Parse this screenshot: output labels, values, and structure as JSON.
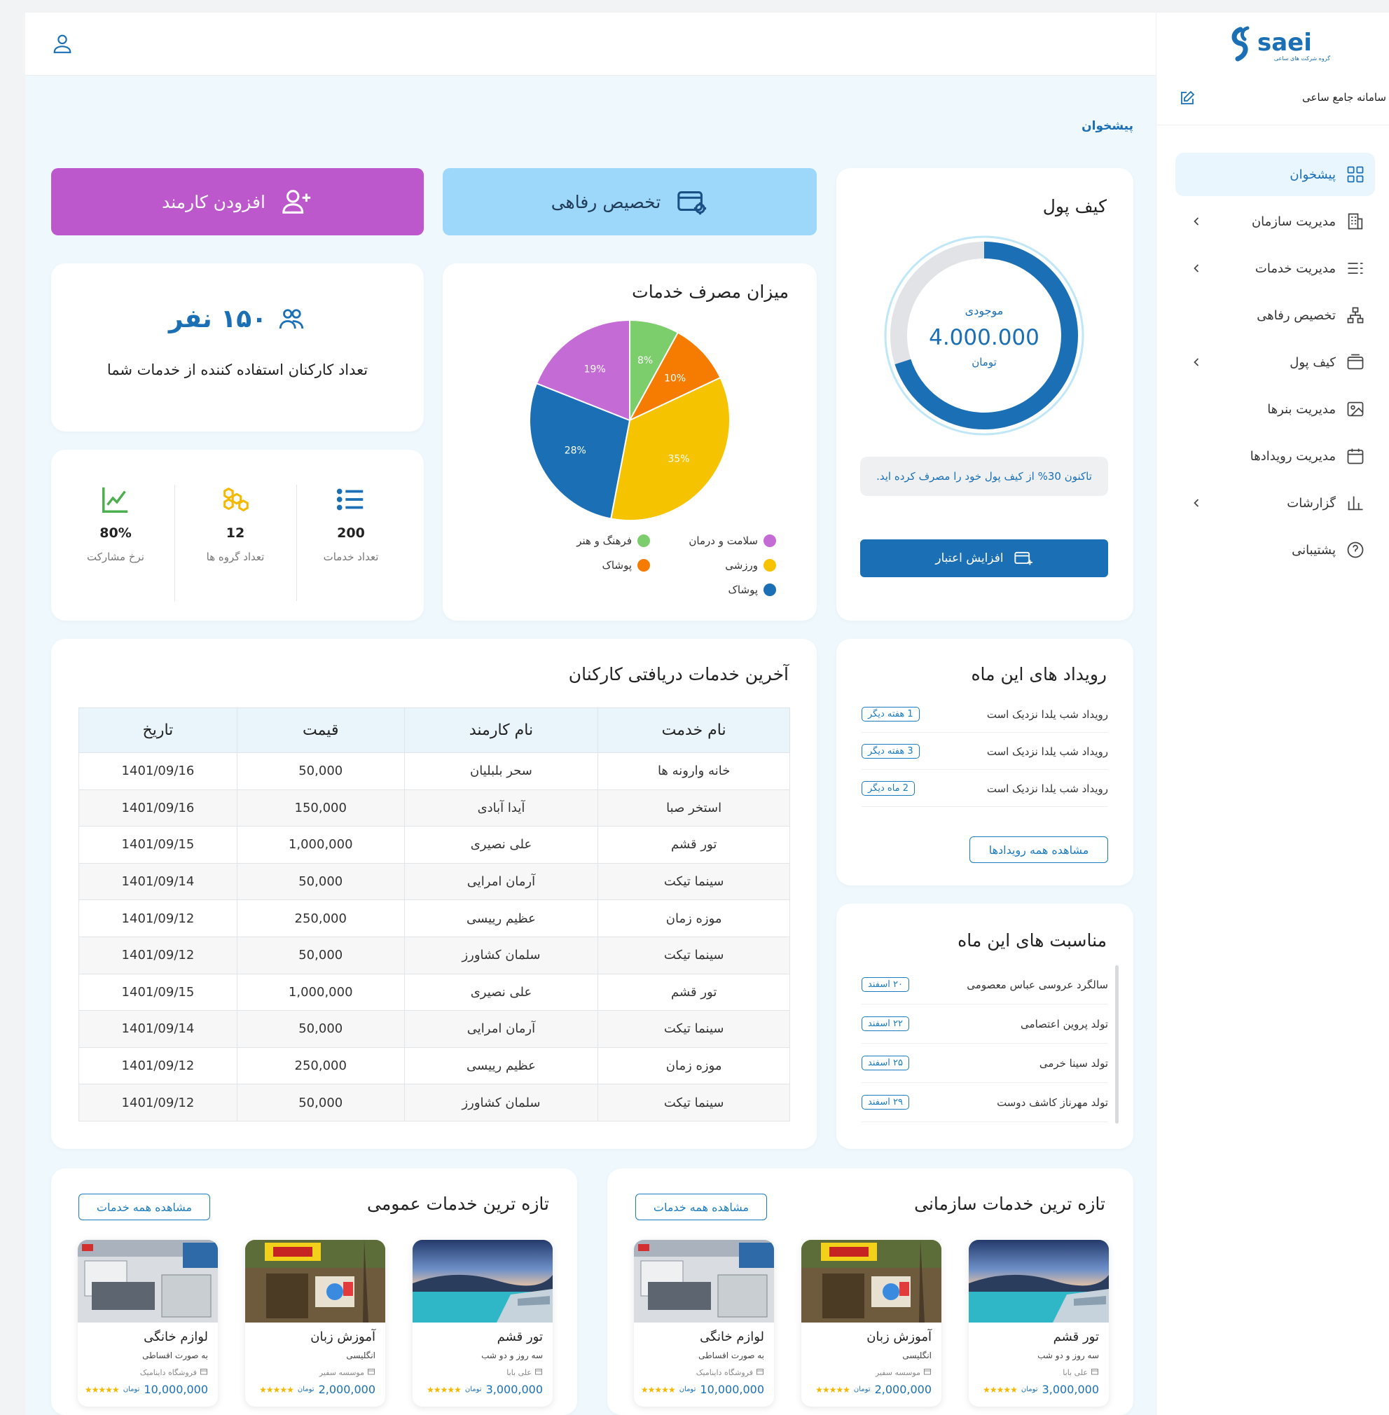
{
  "sidebar": {
    "logo_text": "saei",
    "logo_sub": "گروه شرکت های ساعی",
    "system_title": "سامانه جامع ساعی",
    "items": [
      {
        "label": "پیشخوان",
        "active": true,
        "has_chevron": false
      },
      {
        "label": "مدیریت سازمان",
        "active": false,
        "has_chevron": true
      },
      {
        "label": "مدیریت خدمات",
        "active": false,
        "has_chevron": true
      },
      {
        "label": "تخصیص رفاهی",
        "active": false,
        "has_chevron": false
      },
      {
        "label": "کیف پول",
        "active": false,
        "has_chevron": true
      },
      {
        "label": "مدیریت بنرها",
        "active": false,
        "has_chevron": false
      },
      {
        "label": "مدیریت رویدادها",
        "active": false,
        "has_chevron": false
      },
      {
        "label": "گزارشات",
        "active": false,
        "has_chevron": true
      },
      {
        "label": "پشتیبانی",
        "active": false,
        "has_chevron": false
      }
    ]
  },
  "breadcrumb": "پیشخوان",
  "actions": {
    "add_employee": "افزودن کارمند",
    "welfare_allocation": "تخصیص رفاهی"
  },
  "colors": {
    "primary": "#1a6fb5",
    "purple": "#bd58cc",
    "light_blue": "#9dd8fb",
    "background": "#eef8fd"
  },
  "employees": {
    "count": "۱۵۰ نفر",
    "caption": "تعداد کارکنان استفاده کننده از خدمات شما"
  },
  "stats": [
    {
      "value": "200",
      "label": "تعداد خدمات"
    },
    {
      "value": "12",
      "label": "تعداد گروه ها"
    },
    {
      "value": "80%",
      "label": "نرخ مشارکت"
    }
  ],
  "chart_data": {
    "type": "pie",
    "title": "میزان مصرف خدمات",
    "slices": [
      {
        "label": "فرهنگ و هنر",
        "value": 8,
        "color": "#7ccd6c"
      },
      {
        "label": "پوشاک",
        "value": 10,
        "color": "#f57c00"
      },
      {
        "label": "ورزشی",
        "value": 35,
        "color": "#f6c300"
      },
      {
        "label": "پوشاک",
        "value": 28,
        "color": "#1a6fb5"
      },
      {
        "label": "سلامت و درمان",
        "value": 19,
        "color": "#c56bd6"
      }
    ],
    "legend_position": "bottom"
  },
  "wallet": {
    "title": "کیف پول",
    "balance_label": "موجودی",
    "balance": "4.000.000",
    "currency": "تومان",
    "used_fraction": 0.7,
    "note": "تاکنون 30% از کیف پول خود را مصرف کرده اید.",
    "topup_label": "افزایش اعتبار"
  },
  "recent": {
    "title": "آخرین خدمات دریافتی کارکنان",
    "headers": [
      "نام خدمت",
      "نام کارمند",
      "قیمت",
      "تاریخ"
    ],
    "rows": [
      [
        "خانه وارونه ها",
        "سحر بلبلیان",
        "50,000",
        "1401/09/16"
      ],
      [
        "استخر صبا",
        "آیدا آبادی",
        "150,000",
        "1401/09/16"
      ],
      [
        "تور قشم",
        "علی نصیری",
        "1,000,000",
        "1401/09/15"
      ],
      [
        "سینما تیکت",
        "آرمان امرایی",
        "50,000",
        "1401/09/14"
      ],
      [
        "موزه زمان",
        "عظیم رییسی",
        "250,000",
        "1401/09/12"
      ],
      [
        "سینما تیکت",
        "سلمان کشاورز",
        "50,000",
        "1401/09/12"
      ],
      [
        "تور قشم",
        "علی نصیری",
        "1,000,000",
        "1401/09/15"
      ],
      [
        "سینما تیکت",
        "آرمان امرایی",
        "50,000",
        "1401/09/14"
      ],
      [
        "موزه زمان",
        "عظیم رییسی",
        "250,000",
        "1401/09/12"
      ],
      [
        "سینما تیکت",
        "سلمان کشاورز",
        "50,000",
        "1401/09/12"
      ]
    ]
  },
  "events": {
    "title": "رویداد های این ماه",
    "items": [
      {
        "text": "رویداد شب یلدا نزدیک است",
        "badge": "1 هفته دیگر"
      },
      {
        "text": "رویداد شب یلدا نزدیک است",
        "badge": "3 هفته دیگر"
      },
      {
        "text": "رویداد شب یلدا نزدیک است",
        "badge": "2 ماه دیگر"
      }
    ],
    "view_all": "مشاهده همه رویدادها"
  },
  "occasions": {
    "title": "مناسبت های این ماه",
    "items": [
      {
        "text": "سالگرد عروسی عباس معصومی",
        "badge": "۲۰ اسفند"
      },
      {
        "text": "تولد پروین اعتصامی",
        "badge": "۲۲ اسفند"
      },
      {
        "text": "تولد سینا خرمی",
        "badge": "۲۵ اسفند"
      },
      {
        "text": "تولد مهرناز کاشف دوست",
        "badge": "۲۹ اسفند"
      }
    ]
  },
  "org_services": {
    "title": "تازه ترین خدمات سازمانی",
    "view_all": "مشاهده همه خدمات",
    "items": [
      {
        "name": "تور قشم",
        "subtitle": "سه روز و دو شب",
        "vendor": "علی بابا",
        "price": "3,000,000",
        "currency": "تومان",
        "rating": "★★★★★",
        "image": "sea-photo"
      },
      {
        "name": "آموزش زبان",
        "subtitle": "انگلیسی",
        "vendor": "موسسه سفیر",
        "price": "2,000,000",
        "currency": "تومان",
        "rating": "★★★★★",
        "image": "school-photo"
      },
      {
        "name": "لوازم خانگی",
        "subtitle": "به صورت اقساطی",
        "vendor": "فروشگاه دایناميک",
        "price": "10,000,000",
        "currency": "تومان",
        "rating": "★★★★★",
        "image": "store-photo"
      }
    ]
  },
  "public_services": {
    "title": "تازه ترین خدمات عمومی",
    "view_all": "مشاهده همه خدمات",
    "items": [
      {
        "name": "تور قشم",
        "subtitle": "سه روز و دو شب",
        "vendor": "علی بابا",
        "price": "3,000,000",
        "currency": "تومان",
        "rating": "★★★★★",
        "image": "sea-photo"
      },
      {
        "name": "آموزش زبان",
        "subtitle": "انگلیسی",
        "vendor": "موسسه سفیر",
        "price": "2,000,000",
        "currency": "تومان",
        "rating": "★★★★★",
        "image": "school-photo"
      },
      {
        "name": "لوازم خانگی",
        "subtitle": "به صورت اقساطی",
        "vendor": "فروشگاه دایناميک",
        "price": "10,000,000",
        "currency": "تومان",
        "rating": "★★★★★",
        "image": "store-photo"
      }
    ]
  }
}
